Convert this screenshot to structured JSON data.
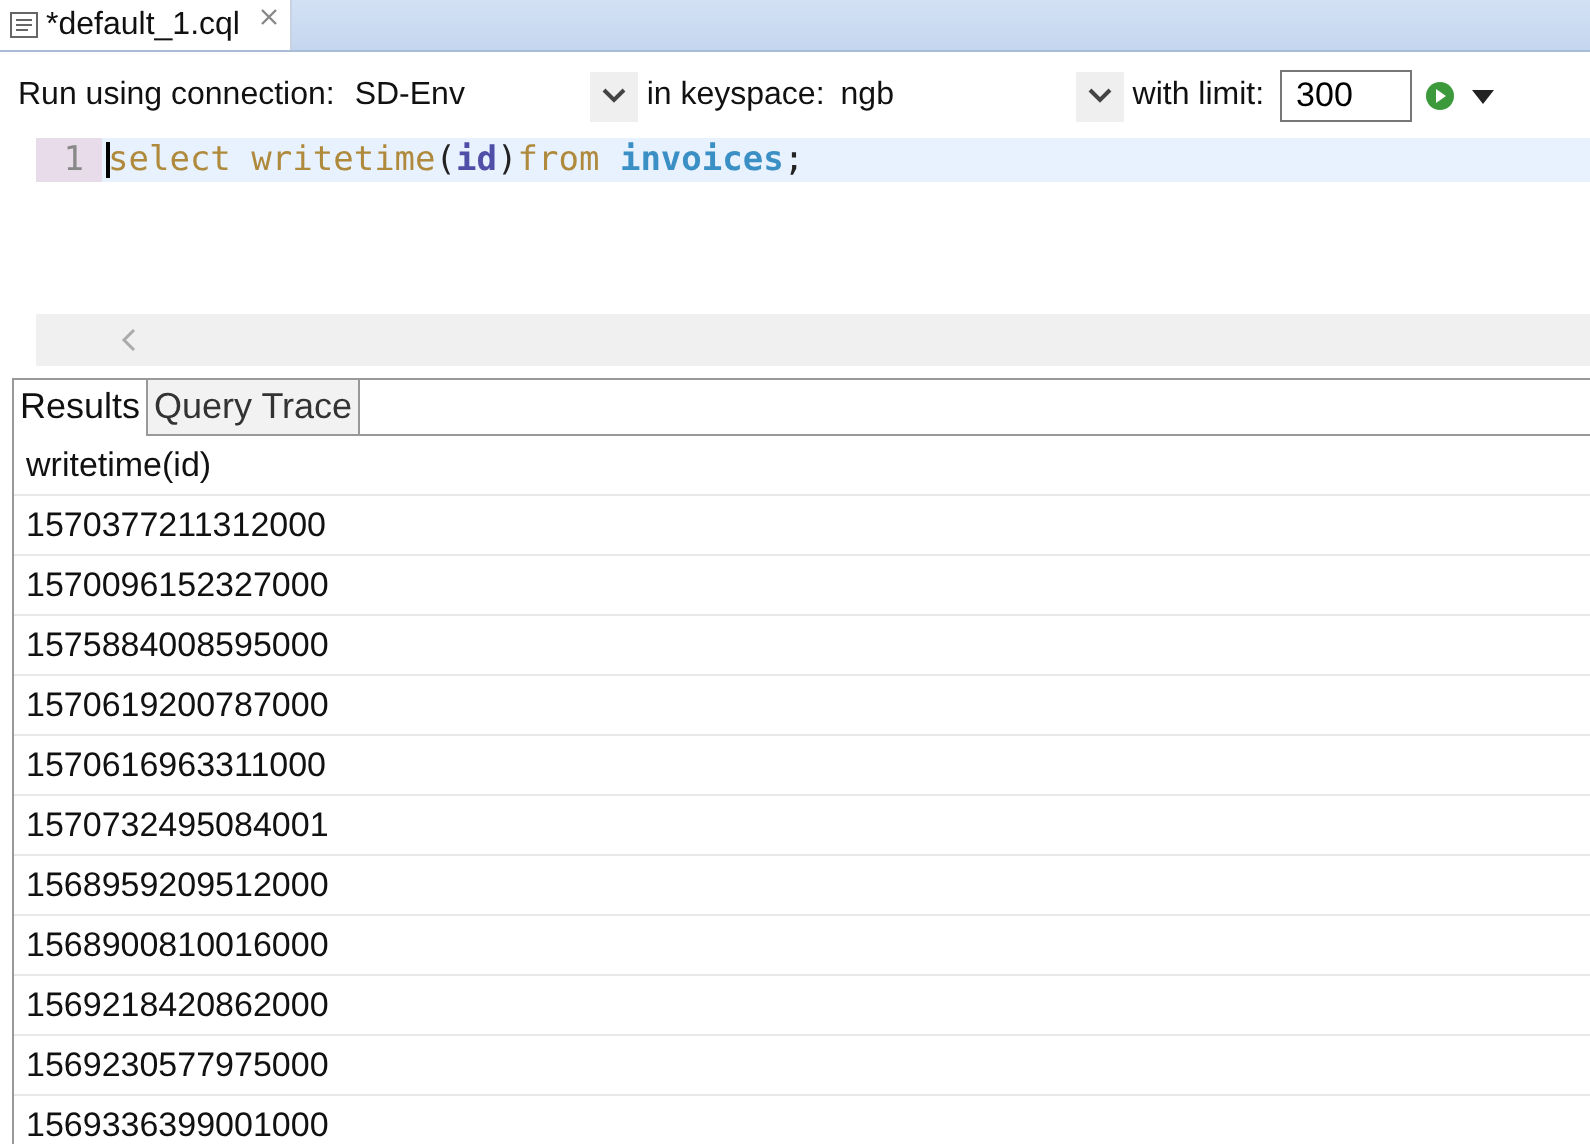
{
  "editor_tab": {
    "title": "*default_1.cql"
  },
  "toolbar": {
    "connection_label": "Run using connection:",
    "connection": "SD-Env",
    "keyspace_label": "in keyspace:",
    "keyspace": "ngb",
    "limit_label": "with limit:",
    "limit": "300"
  },
  "editor": {
    "lines": [
      {
        "number": "1",
        "tokens": [
          {
            "kind": "keyword",
            "text": "select"
          },
          {
            "kind": "function",
            "text": "writetime"
          },
          {
            "kind": "punct",
            "text": "("
          },
          {
            "kind": "column",
            "text": "id"
          },
          {
            "kind": "punct",
            "text": ")"
          },
          {
            "kind": "keyword",
            "text": "from"
          },
          {
            "kind": "table",
            "text": "invoices"
          },
          {
            "kind": "punct",
            "text": ";"
          }
        ]
      }
    ]
  },
  "result_tabs": [
    {
      "label": "Results",
      "selected": true
    },
    {
      "label": "Query Trace",
      "selected": false
    }
  ],
  "table": {
    "columns": [
      "writetime(id)"
    ],
    "rows": [
      [
        "1570377211312000"
      ],
      [
        "1570096152327000"
      ],
      [
        "1575884008595000"
      ],
      [
        "1570619200787000"
      ],
      [
        "1570616963311000"
      ],
      [
        "1570732495084001"
      ],
      [
        "1568959209512000"
      ],
      [
        "1568900810016000"
      ],
      [
        "1569218420862000"
      ],
      [
        "1569230577975000"
      ],
      [
        "1569336399001000"
      ]
    ]
  }
}
